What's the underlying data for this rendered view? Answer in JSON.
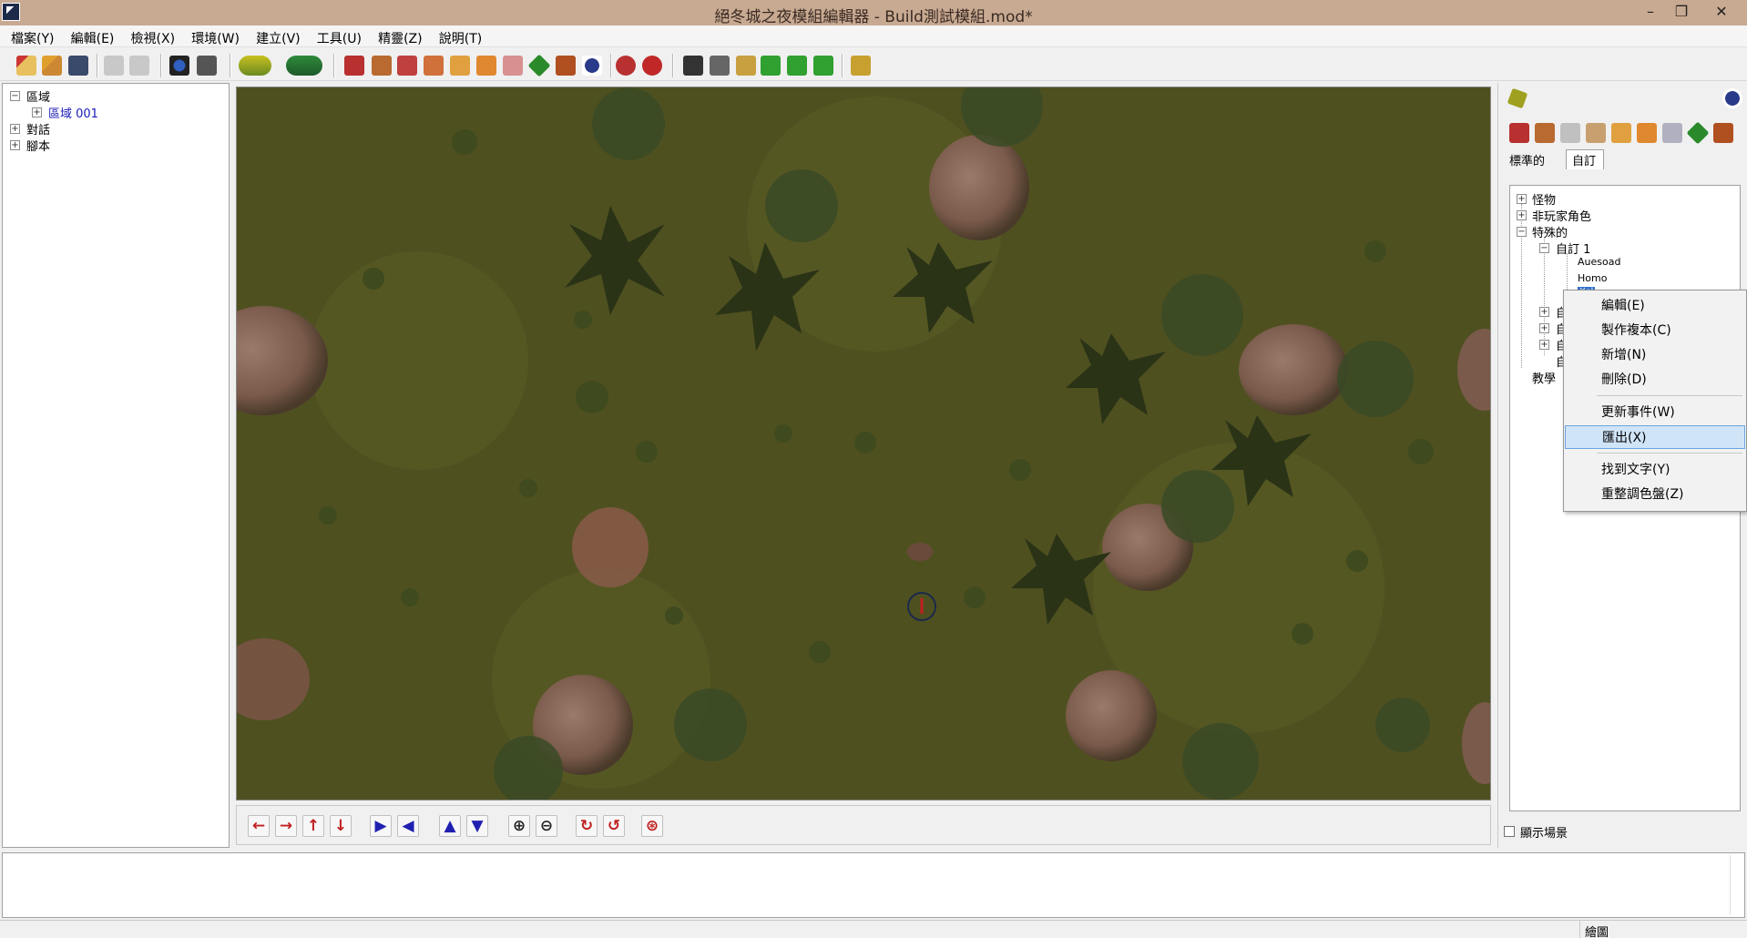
{
  "window": {
    "title": "絕冬城之夜模組編輯器 - Build測試模組.mod*",
    "minimize": "–",
    "maximize": "❐",
    "close": "✕"
  },
  "menu": [
    "檔案(Y)",
    "編輯(E)",
    "檢視(X)",
    "環境(W)",
    "建立(V)",
    "工具(U)",
    "精靈(Z)",
    "說明(T)"
  ],
  "left_tree": {
    "areas_label": "區域",
    "area_item": "區域 001",
    "dialogs_label": "對話",
    "scripts_label": "腳本"
  },
  "palette": {
    "tab_standard": "標準的",
    "tab_custom": "自訂",
    "tree": {
      "monsters": "怪物",
      "npcs": "非玩家角色",
      "special": "特殊的",
      "custom1": "自訂 1",
      "item_a": "Auesoad",
      "item_b": "Homo",
      "item_c": "Xel",
      "e1": "自",
      "e2": "自",
      "e3": "自",
      "e4": "自",
      "tutorial": "教學"
    },
    "show_scene": "顯示場景"
  },
  "context_menu": {
    "edit": "編輯(E)",
    "copy": "製作複本(C)",
    "new": "新增(N)",
    "delete": "刪除(D)",
    "refresh": "更新事件(W)",
    "export": "匯出(X)",
    "find_text": "找到文字(Y)",
    "repalette": "重整調色盤(Z)"
  },
  "status": {
    "right_label": "繪圖"
  },
  "nav_buttons": {
    "left": "←",
    "right": "→",
    "up": "↑",
    "down": "↓",
    "play": "▶",
    "back": "◀",
    "a1": "▲",
    "a2": "▼",
    "zoomin": "⊕",
    "zoomout": "⊖",
    "rot1": "↻",
    "rot2": "↺",
    "cam": "⊛"
  },
  "colors": {
    "titlebar": "#c8aa92",
    "terrain": "#4d4e1f",
    "highlight": "#d0e4f8"
  }
}
